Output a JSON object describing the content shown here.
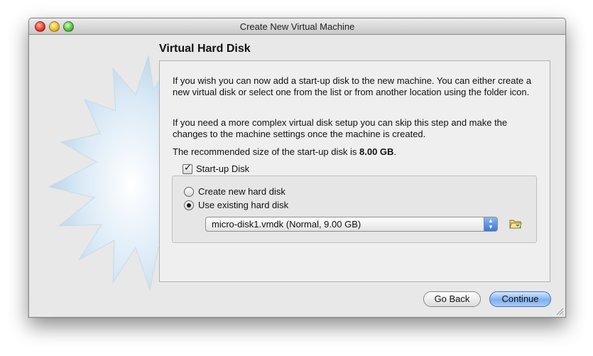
{
  "window": {
    "title": "Create New Virtual Machine"
  },
  "page": {
    "heading": "Virtual Hard Disk",
    "paragraph1": "If you wish you can now add a start-up disk to the new machine. You can either create a new virtual disk or select one from the list or from another location using the folder icon.",
    "paragraph2": "If you need a more complex virtual disk setup you can skip this step and make the changes to the machine settings once the machine is created.",
    "recommended_prefix": "The recommended size of the start-up disk is ",
    "recommended_size": "8.00 GB",
    "recommended_suffix": "."
  },
  "startup_disk": {
    "label": "Start-up Disk",
    "checked": true
  },
  "options": {
    "create_label": "Create new hard disk",
    "existing_label": "Use existing hard disk",
    "selected": "existing"
  },
  "disk_select": {
    "value": "micro-disk1.vmdk (Normal, 9.00 GB)"
  },
  "buttons": {
    "back": "Go Back",
    "continue": "Continue"
  },
  "colors": {
    "default_button": "#7fb0ef",
    "burst": "#cfe3f3"
  },
  "icons": {
    "folder": "folder-icon",
    "traffic_lights": [
      "close",
      "minimize",
      "zoom"
    ]
  }
}
